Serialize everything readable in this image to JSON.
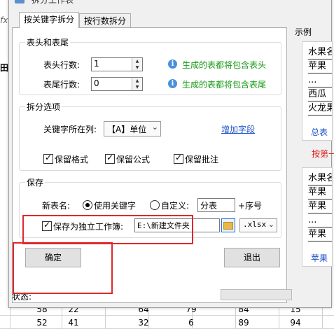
{
  "window": {
    "title": "拆分工作表"
  },
  "background": {
    "rows": [
      [
        "58",
        "22",
        "64",
        "79",
        "84",
        "15"
      ],
      [
        "52",
        "41",
        "32",
        "6",
        "89",
        "94"
      ]
    ],
    "left_chars": [
      "fx",
      "田"
    ]
  },
  "tabs": [
    {
      "label": "按关键字拆分",
      "active": true
    },
    {
      "label": "按行数拆分",
      "active": false
    }
  ],
  "header_footer": {
    "legend": "表头和表尾",
    "header_rows_label": "表头行数:",
    "header_rows_value": "1",
    "header_hint": "生成的表都将包含表头",
    "footer_rows_label": "表尾行数:",
    "footer_rows_value": "0",
    "footer_hint": "生成的表都将包含表尾"
  },
  "split_options": {
    "legend": "拆分选项",
    "key_column_label": "关键字所在列:",
    "key_column_value": "【A】单位",
    "add_field_link": "增加字段",
    "keep_format": "保留格式",
    "keep_formula": "保留公式",
    "keep_comment": "保留批注"
  },
  "save": {
    "legend": "保存",
    "sheet_name_label": "新表名:",
    "use_keyword": "使用关键字",
    "custom": "自定义:",
    "custom_value": "分表",
    "serial_suffix": "+序号",
    "save_as_workbook": "保存为独立工作簿:",
    "path_value": "E:\\新建文件夹",
    "ext_value": ".xlsx"
  },
  "buttons": {
    "ok": "确定",
    "exit": "退出"
  },
  "example": {
    "title": "示例",
    "top_rows": [
      "水果名",
      "苹果",
      "...",
      "西瓜",
      "火龙果"
    ],
    "top_tab": "总表",
    "middle_text": "按第一",
    "bottom_rows": [
      "水果名",
      "苹果",
      "苹果",
      "...",
      "苹果"
    ],
    "bottom_tab": "苹果"
  },
  "status": {
    "label": "状态:"
  }
}
